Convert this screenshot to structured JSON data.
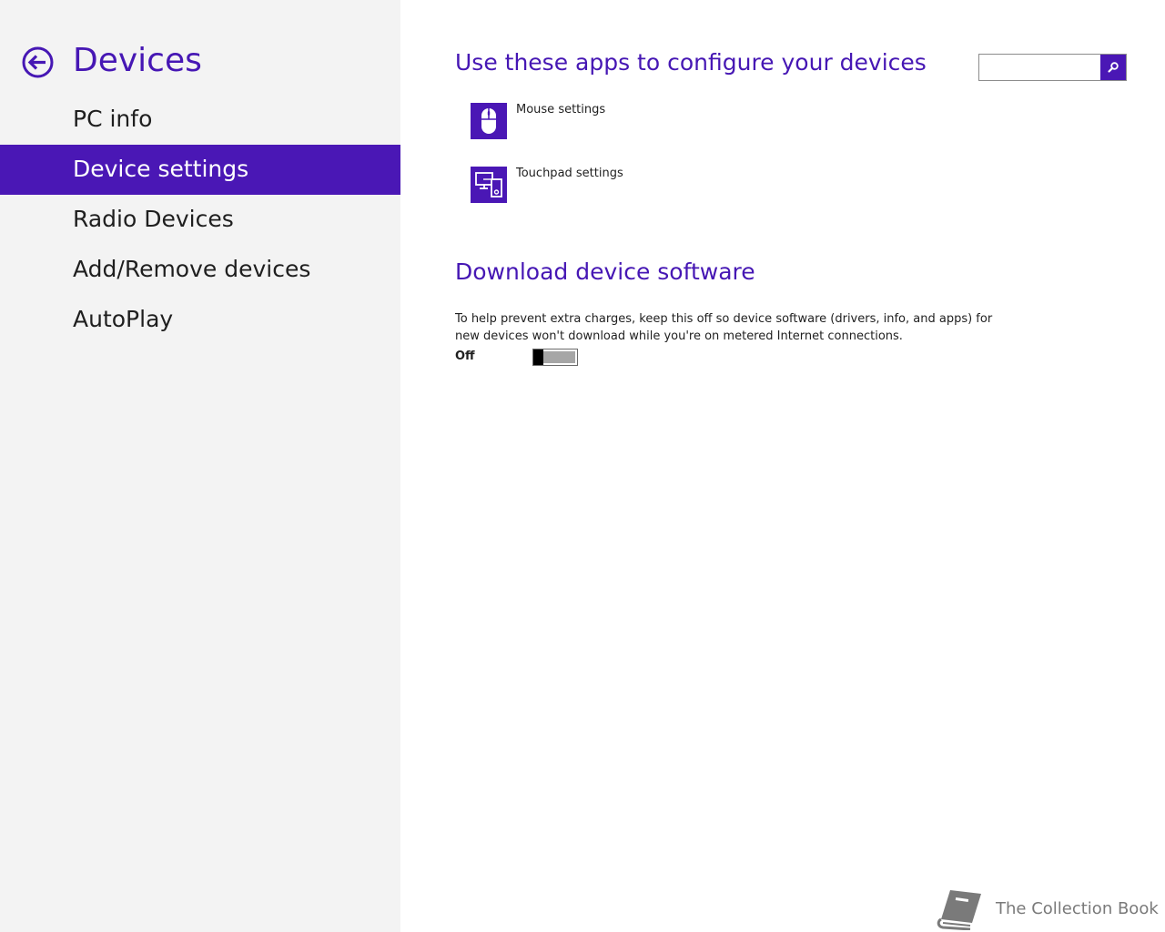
{
  "sidebar": {
    "title": "Devices",
    "items": [
      {
        "label": "PC info",
        "selected": false
      },
      {
        "label": "Device settings",
        "selected": true
      },
      {
        "label": "Radio Devices",
        "selected": false
      },
      {
        "label": "Add/Remove devices",
        "selected": false
      },
      {
        "label": "AutoPlay",
        "selected": false
      }
    ]
  },
  "search": {
    "value": "",
    "placeholder": ""
  },
  "main": {
    "apps_section": {
      "title": "Use these apps to configure your devices",
      "apps": [
        {
          "label": "Mouse settings",
          "icon": "mouse-icon"
        },
        {
          "label": "Touchpad settings",
          "icon": "devices-icon"
        }
      ]
    },
    "download_section": {
      "title": "Download device software",
      "description": "To help prevent extra charges, keep this off so device software (drivers, info, and apps) for new devices won't download while you're on metered Internet connections.",
      "toggle_state": "Off"
    }
  },
  "watermark": {
    "text": "The Collection Book",
    "icon": "book-icon"
  },
  "colors": {
    "accent": "#4a17b5",
    "sidebar_bg": "#f3f3f3",
    "text": "#1f1f1f"
  }
}
